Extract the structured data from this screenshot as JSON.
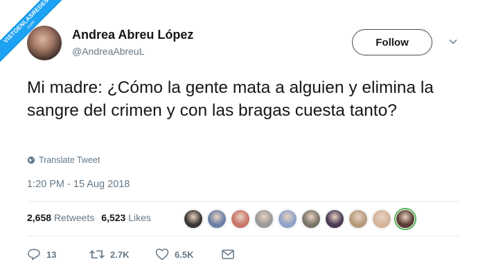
{
  "watermark": {
    "line1": "VISTOENLASREDES",
    "line2": ".com"
  },
  "user": {
    "display_name": "Andrea Abreu López",
    "handle": "@AndreaAbreuL"
  },
  "follow_label": "Follow",
  "tweet_text": "Mi madre: ¿Cómo la gente mata a alguien y elimina la sangre del crimen y con las bragas cuesta tanto?",
  "translate_label": "Translate Tweet",
  "timestamp": "1:20 PM - 15 Aug 2018",
  "stats": {
    "retweets_count": "2,658",
    "retweets_label": "Retweets",
    "likes_count": "6,523",
    "likes_label": "Likes"
  },
  "liker_avatar_colors": [
    "#3b3633",
    "#6b7fa6",
    "#c9746a",
    "#9a9a9a",
    "#8fa2c9",
    "#7a7468",
    "#4a3a55",
    "#b59a7c",
    "#d4b49a",
    "#5a3c34"
  ],
  "actions": {
    "replies": "13",
    "retweets": "2.7K",
    "likes": "6.5K"
  },
  "colors": {
    "text_secondary": "#657786",
    "divider": "#e6ecf0",
    "brand": "#1da1f2"
  }
}
